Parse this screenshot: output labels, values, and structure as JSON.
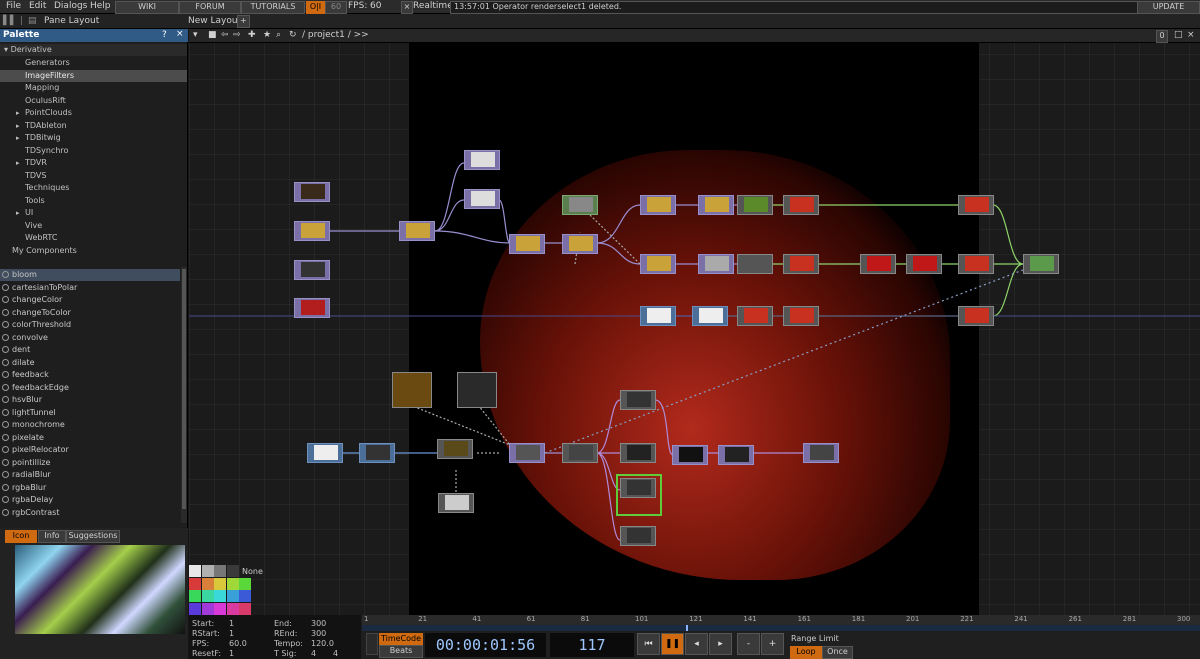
{
  "menubar": {
    "file": "File",
    "edit": "Edit",
    "dialogs": "Dialogs",
    "help": "Help",
    "wiki": "WIKI",
    "forum": "FORUM",
    "tutorials": "TUTORIALS",
    "oi": "O|I",
    "fps_val": "60",
    "fps_label": "FPS:",
    "fps_real": "60",
    "realtime": "Realtime",
    "status": "13:57:01 Operator renderselect1 deleted.",
    "update": "UPDATE"
  },
  "panebar": {
    "pane_layout": "Pane Layout",
    "new_layout": "New Layout",
    "add": "+"
  },
  "palette": {
    "title": "Palette",
    "help": "?",
    "close": "×",
    "root": "Derivative",
    "categories": [
      "Generators",
      "ImageFilters",
      "Mapping",
      "OculusRift",
      "PointClouds",
      "TDAbleton",
      "TDBitwig",
      "TDSynchro",
      "TDVR",
      "TDVS",
      "Techniques",
      "Tools",
      "UI",
      "Vive",
      "WebRTC",
      "My Components"
    ],
    "selected": "ImageFilters",
    "ops": [
      "bloom",
      "cartesianToPolar",
      "changeColor",
      "changeToColor",
      "colorThreshold",
      "convolve",
      "dent",
      "dilate",
      "feedback",
      "feedbackEdge",
      "hsvBlur",
      "lightTunnel",
      "monochrome",
      "pixelate",
      "pixelRelocator",
      "pointillize",
      "radialBlur",
      "rgbaBlur",
      "rgbaDelay",
      "rgbContrast"
    ],
    "selected_op": "bloom",
    "tabs": {
      "icon": "Icon",
      "info": "Info",
      "suggestions": "Suggestions"
    }
  },
  "network": {
    "path": "/ project1 / >>",
    "count": "0"
  },
  "swatches": {
    "none": "None"
  },
  "stats": {
    "start_l": "Start:",
    "start": "1",
    "rstart_l": "RStart:",
    "rstart": "1",
    "fps_l": "FPS:",
    "fps": "60.0",
    "resetf_l": "ResetF:",
    "resetf": "1",
    "end_l": "End:",
    "end": "300",
    "rend_l": "REnd:",
    "rend": "300",
    "tempo_l": "Tempo:",
    "tempo": "120.0",
    "tsig_l": "T Sig:",
    "tsig_a": "4",
    "tsig_b": "4"
  },
  "timeline": {
    "ticks": [
      "1",
      "21",
      "41",
      "61",
      "81",
      "101",
      "121",
      "141",
      "161",
      "181",
      "201",
      "221",
      "241",
      "261",
      "281",
      "300"
    ]
  },
  "transport": {
    "timecode": "TimeCode",
    "beats": "Beats",
    "time": "00:00:01:56",
    "frame": "117",
    "range_limit": "Range Limit",
    "loop": "Loop",
    "once": "Once",
    "minus": "-",
    "plus": "+"
  }
}
